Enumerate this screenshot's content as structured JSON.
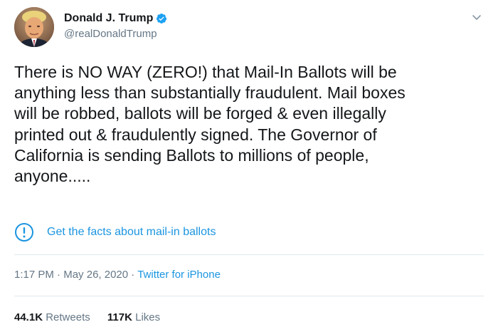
{
  "user": {
    "display_name": "Donald J. Trump",
    "handle": "@realDonaldTrump",
    "verified": true
  },
  "tweet": {
    "text": "There is NO WAY (ZERO!) that Mail-In Ballots will be\nanything less than substantially fraudulent. Mail boxes\nwill be robbed, ballots will be forged & even illegally\nprinted out & fraudulently signed. The Governor of\nCalifornia is sending Ballots to millions of people,\nanyone.....",
    "notice": {
      "icon": "exclamation-circle-icon",
      "link_text": "Get the facts about mail-in ballots"
    },
    "time": "1:17 PM",
    "separator": " · ",
    "date": "May 26, 2020",
    "source": "Twitter for iPhone"
  },
  "stats": {
    "retweets_count": "44.1K",
    "retweets_label": "Retweets",
    "likes_count": "117K",
    "likes_label": "Likes"
  },
  "colors": {
    "accent": "#1b95e0",
    "text": "#14171a",
    "secondary": "#657786",
    "divider": "#e1e8ed"
  },
  "icons": {
    "verified": "verified-badge-icon",
    "caret": "chevron-down-icon",
    "avatar": "avatar"
  }
}
